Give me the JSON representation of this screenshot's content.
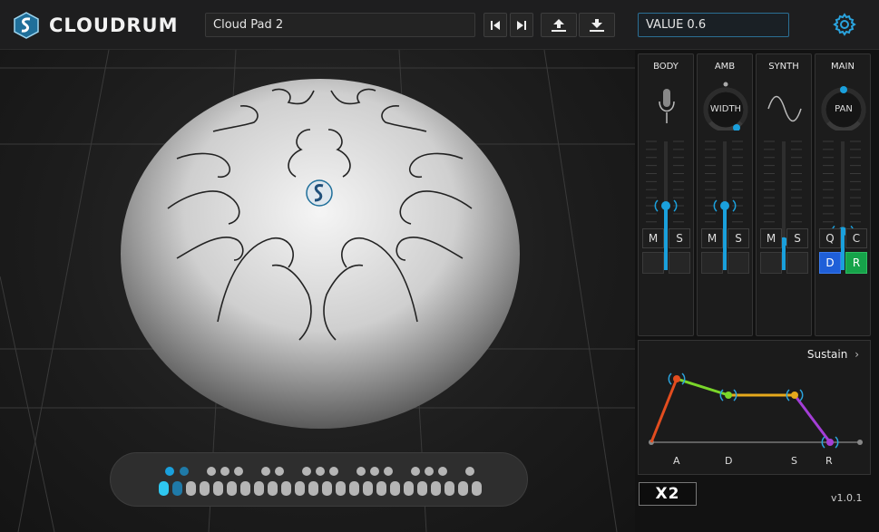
{
  "app": {
    "name": "CLOUDRUM",
    "version": "v1.0.1",
    "badge": "X2"
  },
  "header": {
    "preset_name": "Cloud Pad 2",
    "value_readout": "VALUE 0.6",
    "buttons": [
      "prev-preset-icon",
      "next-preset-icon",
      "upload-icon",
      "download-icon"
    ]
  },
  "strips": [
    {
      "title": "BODY",
      "knob_label": "",
      "fader_level": 0.5,
      "buttons": [
        "M",
        "S"
      ]
    },
    {
      "title": "AMB",
      "knob_label": "WIDTH",
      "fader_level": 0.5,
      "buttons": [
        "M",
        "S"
      ]
    },
    {
      "title": "SYNTH",
      "knob_label": "",
      "fader_level": 0.22,
      "buttons": [
        "M",
        "S"
      ]
    },
    {
      "title": "MAIN",
      "knob_label": "PAN",
      "fader_level": 0.3,
      "buttons": [
        "Q",
        "C"
      ],
      "extra": [
        "D",
        "R"
      ]
    }
  ],
  "envelope": {
    "mode": "Sustain",
    "labels": [
      "A",
      "D",
      "S",
      "R"
    ],
    "colors": {
      "attack": "#e34d1f",
      "decay": "#7ad62a",
      "sustain": "#e6a91c",
      "release": "#a43ed6"
    }
  },
  "accent": "#1aa0dc"
}
